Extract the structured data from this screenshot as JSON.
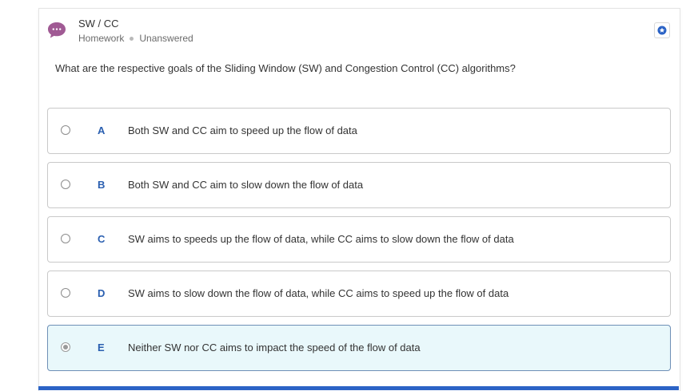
{
  "header": {
    "title": "SW / CC",
    "category": "Homework",
    "status": "Unanswered",
    "avatar_icon": "chat-bubble-icon",
    "bookmark_icon": "star-badge-icon"
  },
  "question": {
    "text": "What are the respective goals of the Sliding Window (SW) and Congestion Control (CC) algorithms?"
  },
  "options": [
    {
      "letter": "A",
      "text": "Both SW and CC aim to speed up the flow of data",
      "selected": false
    },
    {
      "letter": "B",
      "text": "Both SW and CC aim to slow down the flow of data",
      "selected": false
    },
    {
      "letter": "C",
      "text": "SW aims to speeds up the flow of data, while CC aims to slow down the flow of data",
      "selected": false
    },
    {
      "letter": "D",
      "text": "SW aims to slow down the flow of data, while CC aims to speed up the flow of data",
      "selected": false
    },
    {
      "letter": "E",
      "text": "Neither SW nor CC aims to impact the speed of the flow of data",
      "selected": true
    }
  ],
  "colors": {
    "accent": "#2b63c6",
    "avatar": "#a05a94",
    "selected_bg": "#e9f8fb",
    "letter": "#2a5fb0"
  }
}
